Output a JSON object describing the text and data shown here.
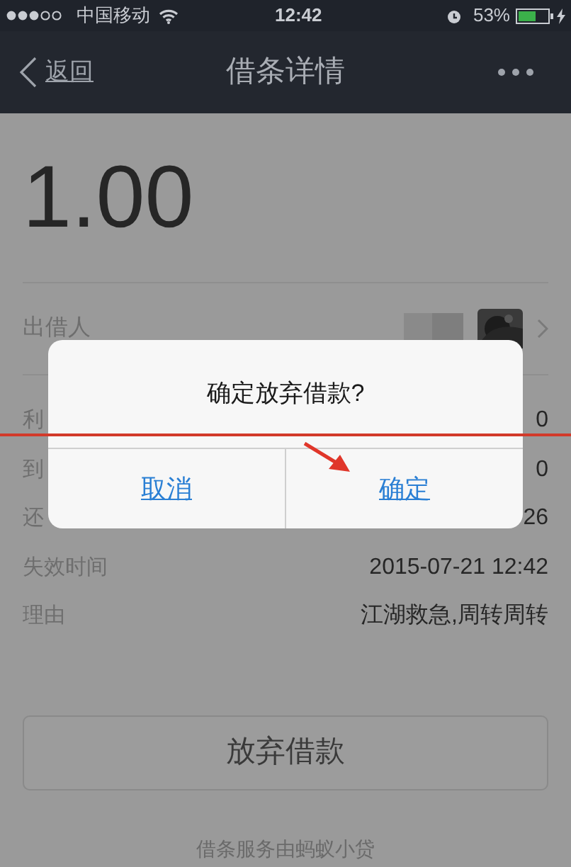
{
  "status_bar": {
    "carrier": "中国移动",
    "time": "12:42",
    "battery": "53%"
  },
  "nav": {
    "back": "返回",
    "title": "借条详情"
  },
  "amount": "1.00",
  "lender": {
    "label": "出借人"
  },
  "rows": [
    {
      "label": "利",
      "value": "0"
    },
    {
      "label": "到",
      "value": "0"
    },
    {
      "label": "还",
      "value": "26"
    },
    {
      "label": "失效时间",
      "value": "2015-07-21 12:42"
    },
    {
      "label": "理由",
      "value": "江湖救急,周转周转"
    }
  ],
  "action_button": "放弃借款",
  "footer": "借条服务由蚂蚁小贷",
  "dialog": {
    "message": "确定放弃借款?",
    "buttons": [
      {
        "label": "取消"
      },
      {
        "label": "确定"
      }
    ]
  }
}
